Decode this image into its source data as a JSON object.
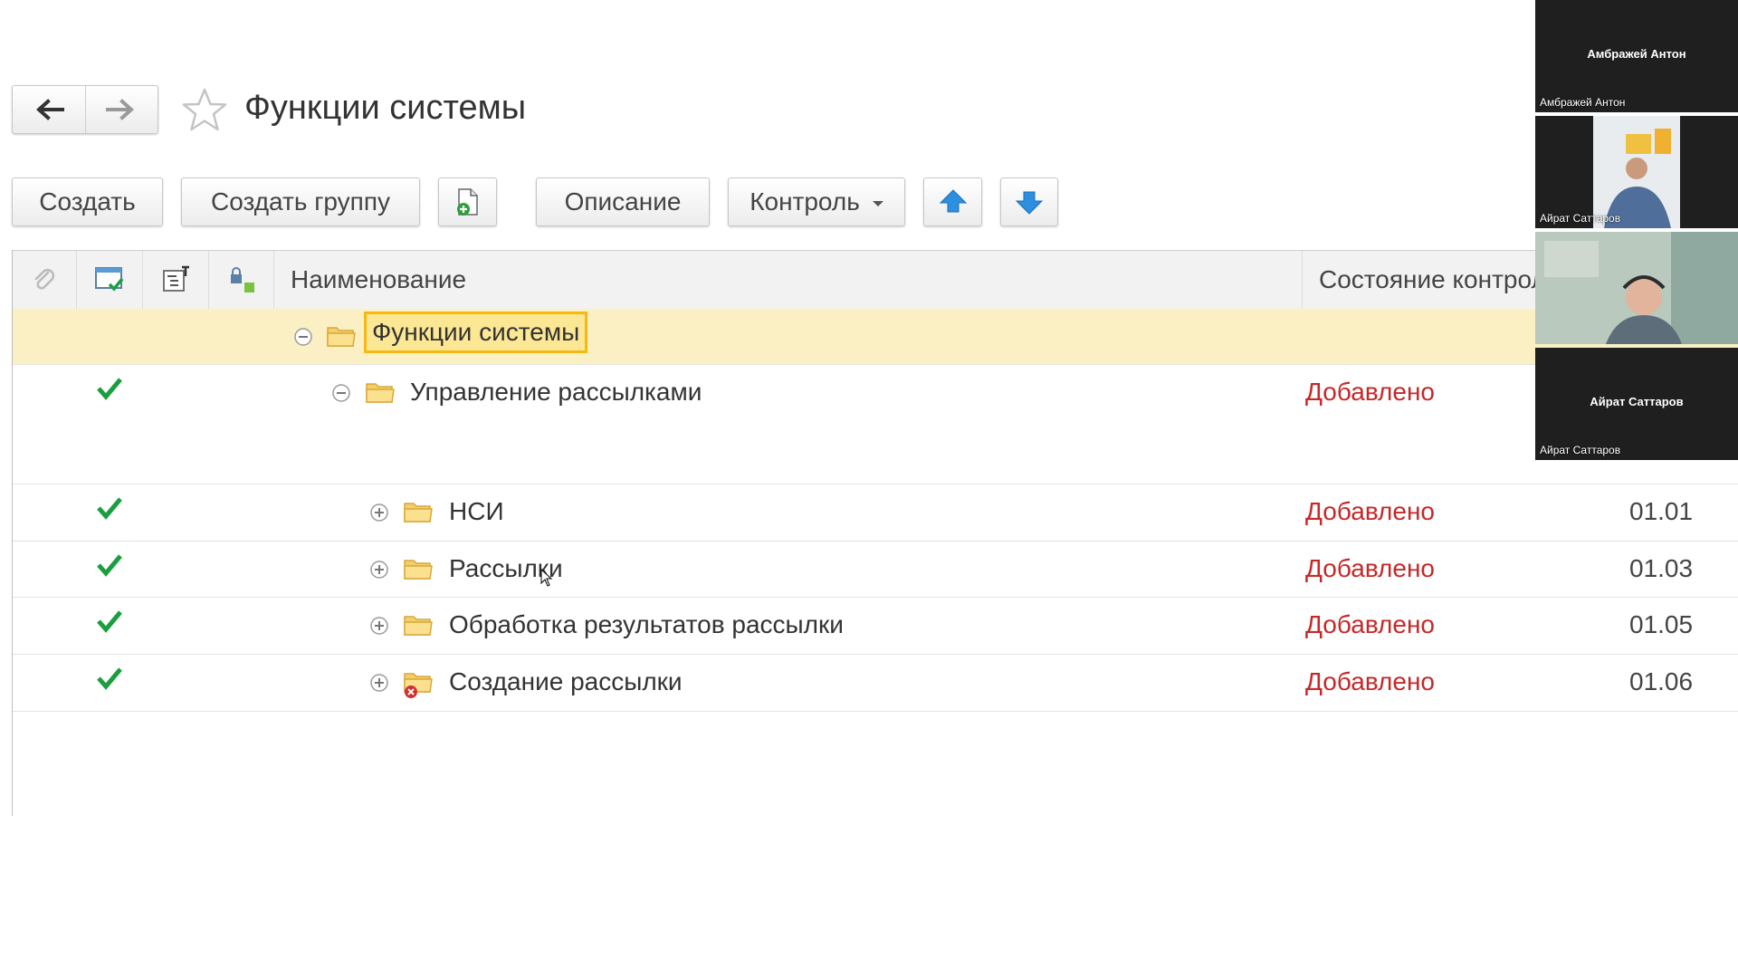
{
  "page": {
    "title": "Функции системы"
  },
  "toolbar": {
    "create": "Создать",
    "create_group": "Создать группу",
    "description": "Описание",
    "control": "Контроль"
  },
  "table": {
    "columns": {
      "name": "Наименование",
      "status": "Состояние контрол"
    },
    "rows": [
      {
        "name": "Функции системы",
        "status": "",
        "code": "",
        "checked": false,
        "expanded": true,
        "selected": true
      },
      {
        "name": "Управление рассылками",
        "status": "Добавлено",
        "code": "",
        "checked": true,
        "expanded": true
      },
      {
        "name": "НСИ",
        "status": "Добавлено",
        "code": "01.01",
        "checked": true,
        "expanded": false
      },
      {
        "name": "Рассылки",
        "status": "Добавлено",
        "code": "01.03",
        "checked": true,
        "expanded": false
      },
      {
        "name": "Обработка результатов рассылки",
        "status": "Добавлено",
        "code": "01.05",
        "checked": true,
        "expanded": false
      },
      {
        "name": "Создание рассылки",
        "status": "Добавлено",
        "code": "01.06",
        "checked": true,
        "expanded": false,
        "marked_error": true
      }
    ]
  },
  "participants": [
    {
      "display": "Амбражей Антон",
      "label": "Амбражей Антон",
      "video": false
    },
    {
      "display": "",
      "label": "Айрат Саттаров",
      "video": true
    },
    {
      "display": "",
      "label": "",
      "video": true
    },
    {
      "display": "Айрат Саттаров",
      "label": "Айрат Саттаров",
      "video": false
    }
  ],
  "colors": {
    "status_added": "#c62828",
    "selected_row": "#fbf0c4",
    "highlight_border": "#f5b912",
    "check": "#1a9e3f"
  }
}
